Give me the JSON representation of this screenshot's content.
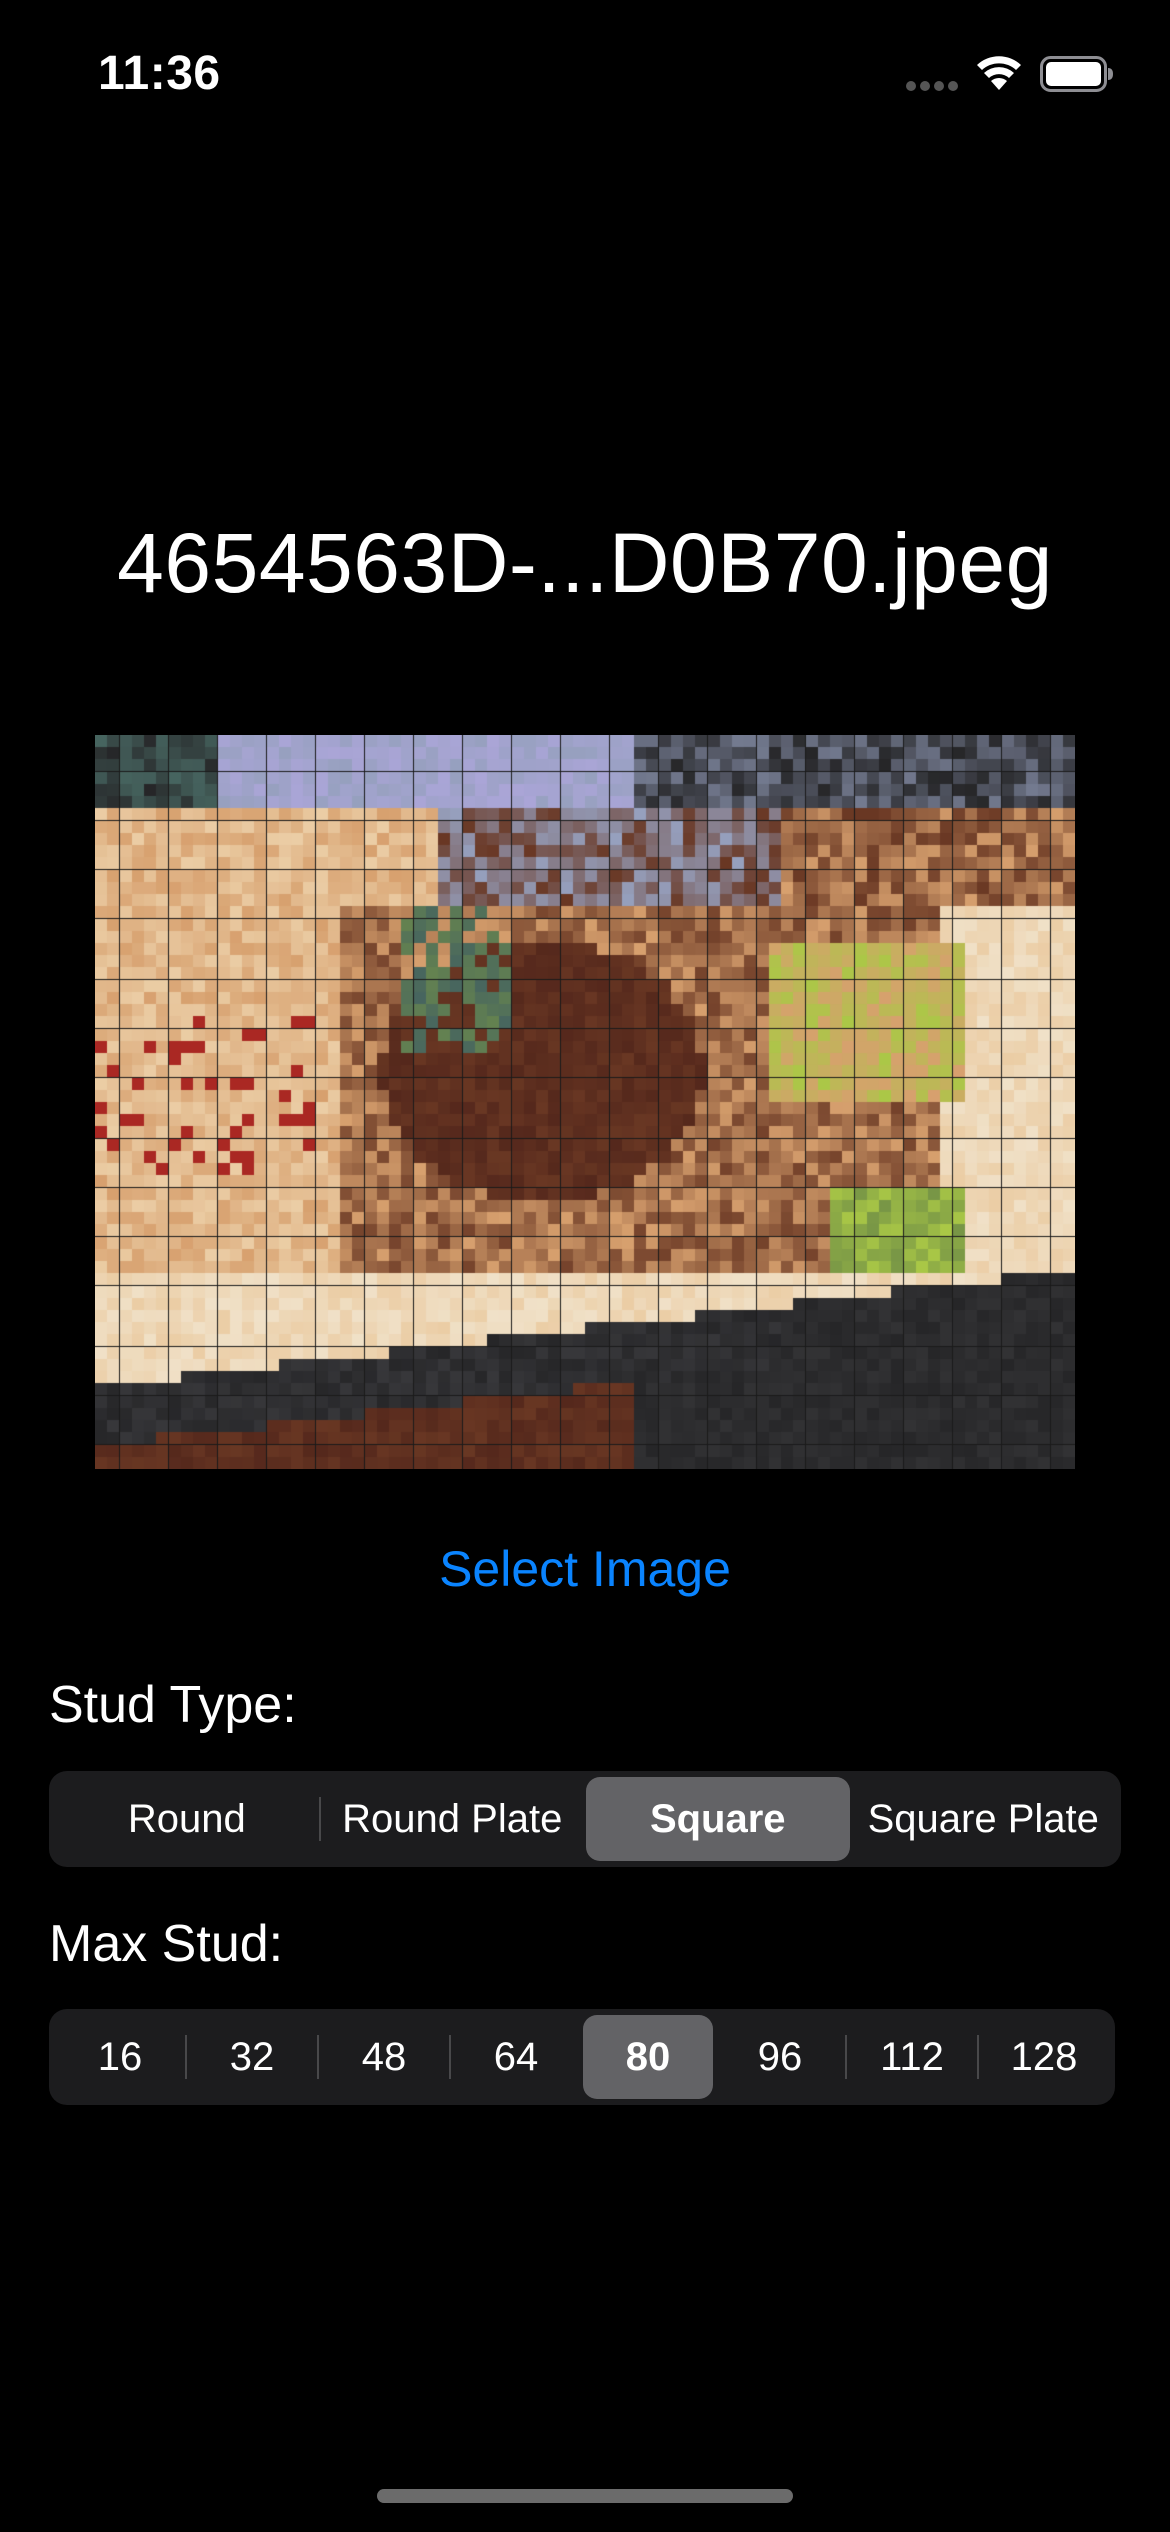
{
  "status_bar": {
    "time": "11:36",
    "icons": [
      "cellular-signal-icon",
      "wifi-icon",
      "battery-icon"
    ]
  },
  "file_title": "4654563D-...D0B70.jpeg",
  "preview": {
    "image": "pixelated mosaic preview of selected photo"
  },
  "select_image_label": "Select Image",
  "stud_type": {
    "label": "Stud Type:",
    "options": [
      "Round",
      "Round Plate",
      "Square",
      "Square Plate"
    ],
    "selected": "Square"
  },
  "max_stud": {
    "label": "Max Stud:",
    "options": [
      "16",
      "32",
      "48",
      "64",
      "80",
      "96",
      "112",
      "128"
    ],
    "selected": "80"
  },
  "colors": {
    "accent": "#0a84ff",
    "background": "#000000",
    "control_bg": "#1c1c1e",
    "selected_segment": "#636366"
  }
}
